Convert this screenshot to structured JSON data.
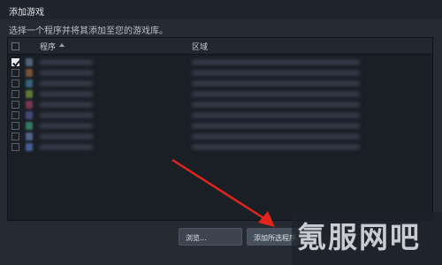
{
  "window": {
    "title": "添加游戏",
    "subtitle": "选择一个程序并将其添加至您的游戏库。"
  },
  "list": {
    "columns": {
      "program": "程序",
      "location": "区域"
    },
    "rows": [
      {
        "checked": true,
        "icon_color": "#5b6f8a"
      },
      {
        "checked": false,
        "icon_color": "#8a5b3a"
      },
      {
        "checked": false,
        "icon_color": "#3a6f8a"
      },
      {
        "checked": false,
        "icon_color": "#6b8a3a"
      },
      {
        "checked": false,
        "icon_color": "#8a3a5b"
      },
      {
        "checked": false,
        "icon_color": "#4a4f8a"
      },
      {
        "checked": false,
        "icon_color": "#3a8a6b"
      },
      {
        "checked": false,
        "icon_color": "#5a6f9a"
      },
      {
        "checked": false,
        "icon_color": "#4a6aa8"
      }
    ]
  },
  "buttons": {
    "browse": "浏览...",
    "add_selected": "添加所选程序"
  },
  "watermark": "氪服网吧",
  "colors": {
    "annotation_arrow": "#e0261c"
  }
}
